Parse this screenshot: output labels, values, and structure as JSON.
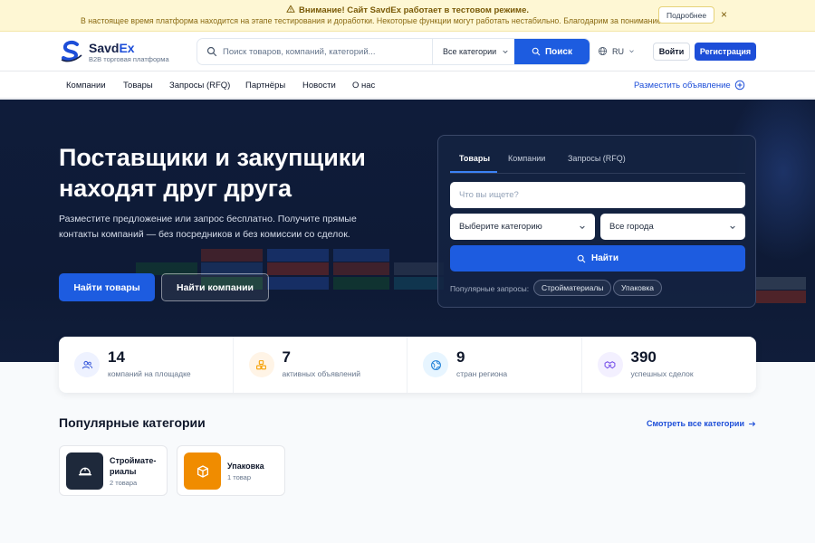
{
  "banner": {
    "title": "Внимание! Сайт SavdEx работает в тестовом режиме.",
    "text": "В настоящее время платформа находится на этапе тестирования и доработки. Некоторые функции могут работать нестабильно. Благодарим за понимание!",
    "more_label": "Подробнее",
    "close": "×"
  },
  "header": {
    "brand_a": "Savd",
    "brand_b": "Ex",
    "tagline": "B2B торговая платформа",
    "search_placeholder": "Поиск товаров, компаний, категорий...",
    "category_select": "Все категории",
    "search_button": "Поиск",
    "lang": "RU",
    "login": "Войти",
    "register": "Регистрация"
  },
  "nav": {
    "items": [
      "Компании",
      "Товары",
      "Запросы (RFQ)",
      "Партнёры",
      "Новости",
      "О нас"
    ],
    "post_ad": "Разместить объявление"
  },
  "hero": {
    "title": "Поставщики и закупщики находят друг друга",
    "description": "Разместите предложение или запрос бесплатно. Получите прямые контакты компаний — без посредников и без комиссии со сделок.",
    "btn_goods": "Найти товары",
    "btn_companies": "Найти компании"
  },
  "search_card": {
    "tabs": [
      "Товары",
      "Компании",
      "Запросы (RFQ)"
    ],
    "query_placeholder": "Что вы ищете?",
    "category_select": "Выберите категорию",
    "city_select": "Все города",
    "find_button": "Найти",
    "popular_label": "Популярные запросы:",
    "chips": [
      "Стройматериалы",
      "Упаковка"
    ]
  },
  "stats": [
    {
      "value": "14",
      "label": "компаний на площадке",
      "icon": "users-icon",
      "bg": "#eef2ff",
      "color": "#3b5bdb"
    },
    {
      "value": "7",
      "label": "активных объявлений",
      "icon": "boxes-icon",
      "bg": "#fff4e6",
      "color": "#f59f00"
    },
    {
      "value": "9",
      "label": "стран региона",
      "icon": "globe-icon",
      "bg": "#e7f5ff",
      "color": "#1c7ed6"
    },
    {
      "value": "390",
      "label": "успешных сделок",
      "icon": "handshake-icon",
      "bg": "#f3f0ff",
      "color": "#7048e8"
    }
  ],
  "categories": {
    "title": "Популярные категории",
    "see_all": "Смотреть все категории",
    "items": [
      {
        "name": "Стройма­те­риалы",
        "count": "2 товара",
        "icon": "helmet-icon",
        "color": "#1e293b"
      },
      {
        "name": "Упаковка",
        "count": "1 товар",
        "icon": "box-icon",
        "color": "#f08c00"
      }
    ]
  },
  "colors": {
    "primary": "#1d5ce0",
    "hero_bg": "#0f1c3a",
    "banner_bg": "#fef7d4"
  }
}
